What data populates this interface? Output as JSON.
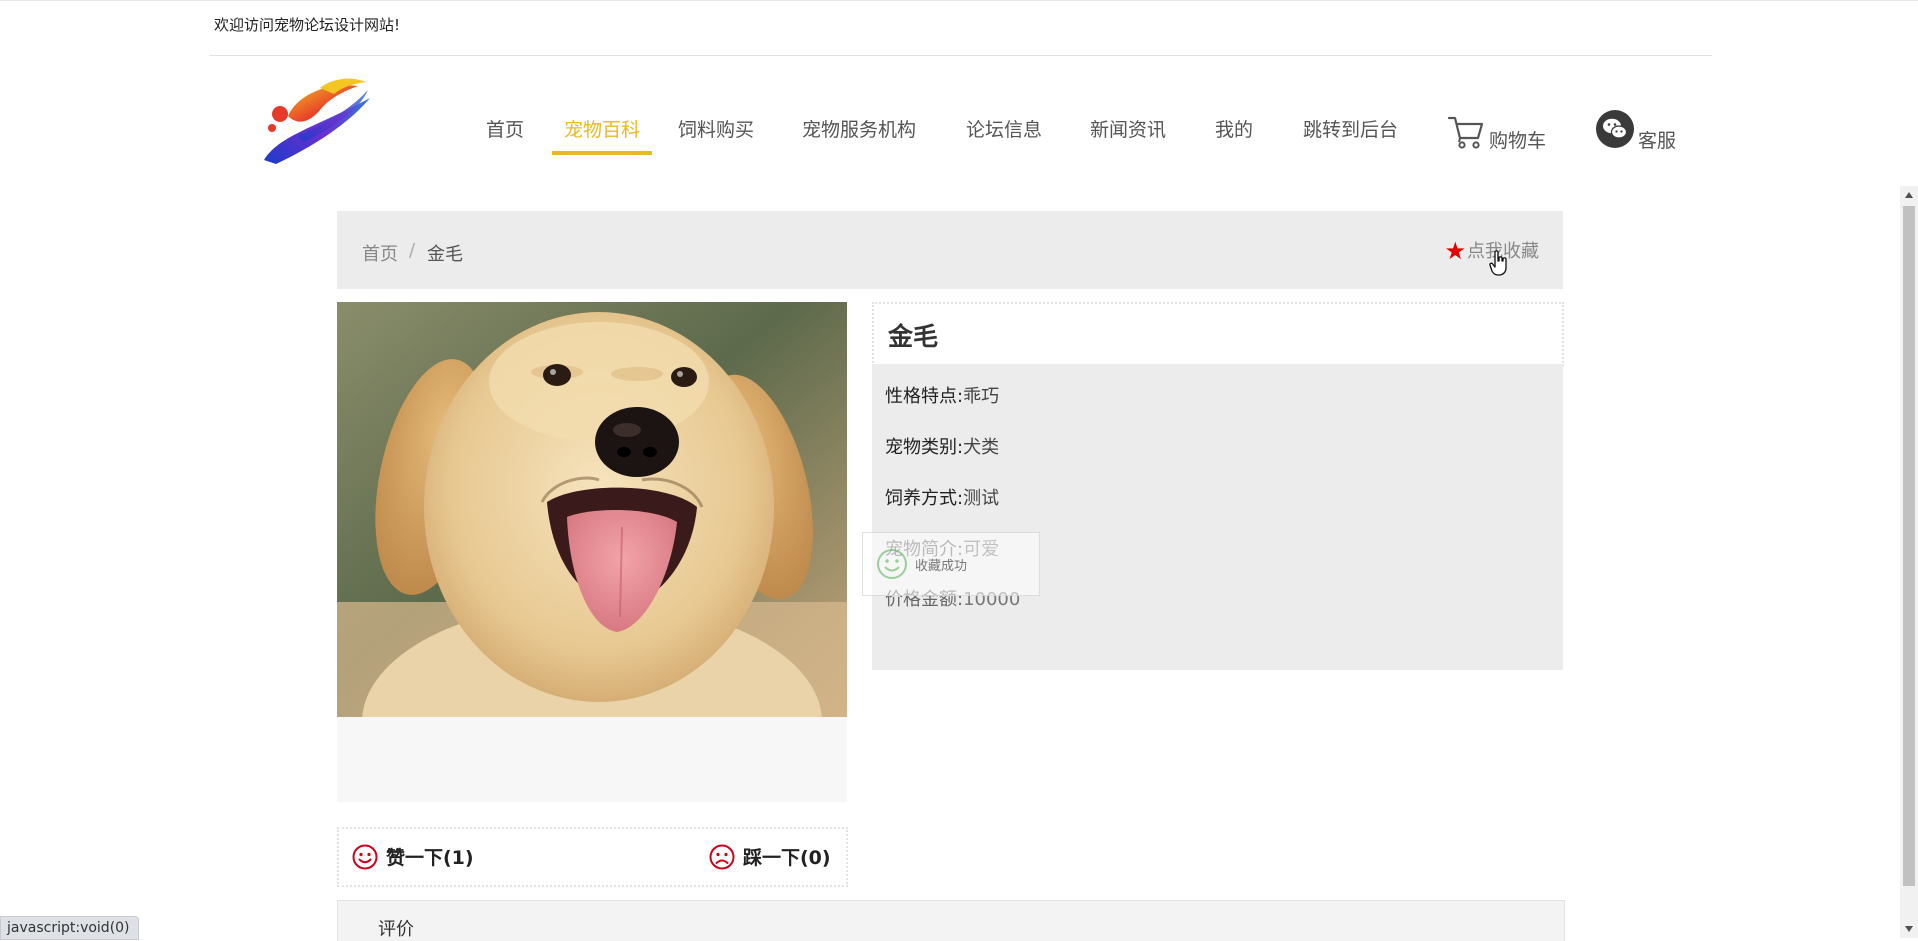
{
  "top": {
    "welcome": "欢迎访问宠物论坛设计网站!"
  },
  "nav": {
    "items": [
      {
        "label": "首页"
      },
      {
        "label": "宠物百科"
      },
      {
        "label": "饲料购买"
      },
      {
        "label": "宠物服务机构"
      },
      {
        "label": "论坛信息"
      },
      {
        "label": "新闻资讯"
      },
      {
        "label": "我的"
      },
      {
        "label": "跳转到后台"
      }
    ],
    "active": "宠物百科",
    "cart_label": "购物车",
    "service_label": "客服"
  },
  "breadcrumb": {
    "home": "首页",
    "separator": "/",
    "current": "金毛"
  },
  "favorite": {
    "label": "点我收藏"
  },
  "pet": {
    "name": "金毛",
    "fields": [
      {
        "key": "性格特点:",
        "value": "乖巧"
      },
      {
        "key": "宠物类别:",
        "value": "犬类"
      },
      {
        "key": "饲养方式:",
        "value": "测试"
      },
      {
        "key": "宠物简介:",
        "value": "可爱"
      },
      {
        "key": "价格金额:",
        "value": "10000"
      }
    ]
  },
  "toast": {
    "message": "收藏成功"
  },
  "votes": {
    "like_label": "赞一下(1)",
    "dislike_label": "踩一下(0)"
  },
  "comments": {
    "title": "评价"
  },
  "status_bar": {
    "text": "javascript:void(0)"
  },
  "colors": {
    "accent": "#e8b923",
    "star": "#e30000",
    "vote_icon": "#d0021b",
    "toast_icon": "#5cb85c"
  }
}
